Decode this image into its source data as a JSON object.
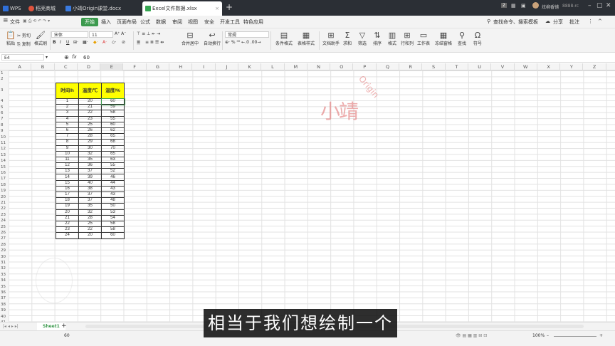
{
  "titlebar": {
    "tabs": [
      {
        "label": "WPS",
        "color": "#2f6fd8"
      },
      {
        "label": "稻壳商城",
        "color": "#e0533d"
      },
      {
        "label": "小靖Origin课堂.docx",
        "color": "#3a7be0"
      },
      {
        "label": "Excel文件数据.xlsx",
        "color": "#35a551",
        "active": true
      }
    ],
    "new_tab": "+",
    "badge": "2",
    "user_name": "炫柳香铺",
    "user_extra": "8888-rc"
  },
  "menubar": {
    "file": "文件",
    "items": [
      "开始",
      "插入",
      "页面布局",
      "公式",
      "数据",
      "审阅",
      "视图",
      "安全",
      "开发工具",
      "特色应用"
    ],
    "active_index": 0,
    "search": "查找命令、搜索模板",
    "share": "分享",
    "comment": "批注"
  },
  "ribbon": {
    "paste": "粘贴",
    "cut": "剪切",
    "copy": "复制",
    "format_painter": "格式刷",
    "font_name": "宋体",
    "font_size": "11",
    "merge": "合并居中",
    "wrap": "自动换行",
    "number_format": "常规",
    "cond_format": "条件格式",
    "table_style": "表格样式",
    "doc_helper": "文档助手",
    "sum": "求和",
    "filter": "筛选",
    "sort": "排序",
    "format": "格式",
    "rowcol": "行和列",
    "worksheet": "工作表",
    "freeze": "冻结窗格",
    "find": "查找",
    "symbol": "符号"
  },
  "formula_bar": {
    "cell_ref": "E4",
    "fx": "fx",
    "value": "60"
  },
  "columns": [
    "A",
    "B",
    "C",
    "D",
    "E",
    "F",
    "G",
    "H",
    "I",
    "J",
    "K",
    "L",
    "M",
    "N",
    "O",
    "P",
    "Q",
    "R",
    "S",
    "T",
    "U",
    "V",
    "W",
    "X",
    "Y",
    "Z"
  ],
  "rows": [
    "1",
    "2",
    "3",
    "4",
    "5",
    "6",
    "7",
    "8",
    "9",
    "10",
    "11",
    "12",
    "13",
    "14",
    "15",
    "16",
    "17",
    "18",
    "19",
    "20",
    "21",
    "22",
    "23",
    "24",
    "25",
    "26",
    "27",
    "28",
    "29",
    "30",
    "31",
    "32",
    "33",
    "34",
    "35",
    "36",
    "37",
    "38",
    "39",
    "40",
    "41",
    "42"
  ],
  "table": {
    "headers": [
      "时间/h",
      "温度/℃",
      "湿度/%"
    ],
    "rows": [
      [
        "1",
        "20",
        "60"
      ],
      [
        "2",
        "21",
        "59"
      ],
      [
        "3",
        "22",
        "58"
      ],
      [
        "4",
        "23",
        "55"
      ],
      [
        "5",
        "25",
        "60"
      ],
      [
        "6",
        "26",
        "62"
      ],
      [
        "7",
        "28",
        "65"
      ],
      [
        "8",
        "29",
        "68"
      ],
      [
        "9",
        "30",
        "70"
      ],
      [
        "10",
        "32",
        "65"
      ],
      [
        "11",
        "35",
        "63"
      ],
      [
        "12",
        "36",
        "55"
      ],
      [
        "13",
        "37",
        "52"
      ],
      [
        "14",
        "39",
        "46"
      ],
      [
        "15",
        "40",
        "44"
      ],
      [
        "16",
        "38",
        "43"
      ],
      [
        "17",
        "37",
        "43"
      ],
      [
        "18",
        "37",
        "48"
      ],
      [
        "19",
        "35",
        "50"
      ],
      [
        "20",
        "32",
        "53"
      ],
      [
        "21",
        "28",
        "54"
      ],
      [
        "22",
        "25",
        "58"
      ],
      [
        "23",
        "22",
        "58"
      ],
      [
        "24",
        "20",
        "60"
      ]
    ]
  },
  "watermark": {
    "chinese": "小靖",
    "latin": "Origin"
  },
  "sheetbar": {
    "sheet": "Sheet1",
    "add": "+"
  },
  "statusbar": {
    "value": "60",
    "zoom": "100%"
  },
  "subtitle": "相当于我们想绘制一个"
}
